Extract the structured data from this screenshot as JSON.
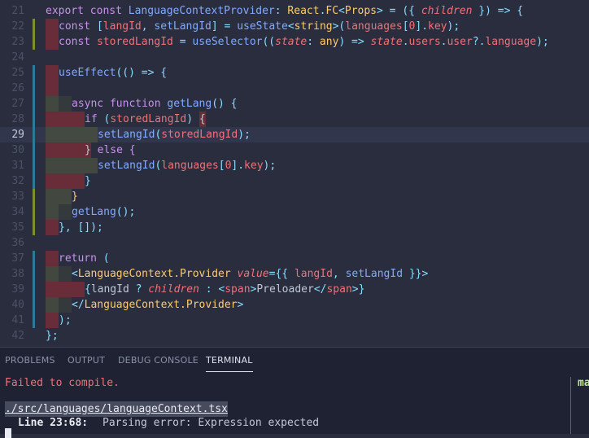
{
  "editor": {
    "active_line": "29",
    "lines": [
      {
        "num": "21",
        "gutter": "none",
        "tokens": [
          {
            "t": "export const ",
            "c": "kw"
          },
          {
            "t": "LanguageContextProvider",
            "c": "fn"
          },
          {
            "t": ": ",
            "c": "pu"
          },
          {
            "t": "React",
            "c": "ty"
          },
          {
            "t": ".",
            "c": "pu"
          },
          {
            "t": "FC",
            "c": "ty"
          },
          {
            "t": "<",
            "c": "pu"
          },
          {
            "t": "Props",
            "c": "ty"
          },
          {
            "t": "> = ({ ",
            "c": "pu"
          },
          {
            "t": "children",
            "c": "it"
          },
          {
            "t": " }) => {",
            "c": "pu"
          }
        ]
      },
      {
        "num": "22",
        "gutter": "add",
        "tokens": [
          {
            "t": "",
            "c": "rb",
            "w": 16
          },
          {
            "t": "const ",
            "c": "kw"
          },
          {
            "t": "[",
            "c": "pu"
          },
          {
            "t": "langId",
            "c": "vr"
          },
          {
            "t": ", ",
            "c": "pu"
          },
          {
            "t": "setLangId",
            "c": "fn"
          },
          {
            "t": "] = ",
            "c": "pu"
          },
          {
            "t": "useState",
            "c": "fn"
          },
          {
            "t": "<",
            "c": "pu"
          },
          {
            "t": "string",
            "c": "ty"
          },
          {
            "t": ">(",
            "c": "pu"
          },
          {
            "t": "languages",
            "c": "vr"
          },
          {
            "t": "[",
            "c": "pu"
          },
          {
            "t": "0",
            "c": "vr"
          },
          {
            "t": "].",
            "c": "pu"
          },
          {
            "t": "key",
            "c": "vr"
          },
          {
            "t": ");",
            "c": "pu"
          }
        ]
      },
      {
        "num": "23",
        "gutter": "add",
        "tokens": [
          {
            "t": "",
            "c": "rb",
            "w": 16
          },
          {
            "t": "const ",
            "c": "kw"
          },
          {
            "t": "storedLangId",
            "c": "vr"
          },
          {
            "t": " = ",
            "c": "pu"
          },
          {
            "t": "useSelector",
            "c": "fn"
          },
          {
            "t": "((",
            "c": "pu"
          },
          {
            "t": "state",
            "c": "it"
          },
          {
            "t": ": ",
            "c": "pu"
          },
          {
            "t": "any",
            "c": "ty"
          },
          {
            "t": ") => ",
            "c": "pu"
          },
          {
            "t": "state",
            "c": "it"
          },
          {
            "t": ".",
            "c": "pu"
          },
          {
            "t": "users",
            "c": "vr"
          },
          {
            "t": ".",
            "c": "pu"
          },
          {
            "t": "user",
            "c": "vr"
          },
          {
            "t": "?.",
            "c": "pu"
          },
          {
            "t": "language",
            "c": "vr"
          },
          {
            "t": ");",
            "c": "pu"
          }
        ]
      },
      {
        "num": "24",
        "gutter": "none",
        "tokens": []
      },
      {
        "num": "25",
        "gutter": "mod",
        "tokens": [
          {
            "t": "",
            "c": "rb",
            "w": 16
          },
          {
            "t": "useEffect",
            "c": "fn"
          },
          {
            "t": "(() => {",
            "c": "pu"
          }
        ]
      },
      {
        "num": "26",
        "gutter": "mod",
        "tokens": [
          {
            "t": "",
            "c": "rb",
            "w": 16
          }
        ]
      },
      {
        "num": "27",
        "gutter": "mod",
        "tokens": [
          {
            "t": "",
            "c": "gb",
            "w": 16
          },
          {
            "t": "",
            "c": "gl",
            "w": 16
          },
          {
            "t": "async function ",
            "c": "kw"
          },
          {
            "t": "getLang",
            "c": "fn"
          },
          {
            "t": "() {",
            "c": "pu"
          }
        ]
      },
      {
        "num": "28",
        "gutter": "mod",
        "tokens": [
          {
            "t": "",
            "c": "rb",
            "w": 16
          },
          {
            "t": "",
            "c": "rb",
            "w": 16
          },
          {
            "t": "",
            "c": "rb",
            "w": 16
          },
          {
            "t": "if ",
            "c": "kw"
          },
          {
            "t": "(",
            "c": "pu"
          },
          {
            "t": "storedLangId",
            "c": "vr"
          },
          {
            "t": ") ",
            "c": "pu"
          },
          {
            "t": "{",
            "c": "rb"
          }
        ]
      },
      {
        "num": "29",
        "gutter": "mod",
        "tokens": [
          {
            "t": "",
            "c": "gb",
            "w": 16
          },
          {
            "t": "",
            "c": "gb",
            "w": 16
          },
          {
            "t": "",
            "c": "gb",
            "w": 16
          },
          {
            "t": "",
            "c": "gb",
            "w": 16
          },
          {
            "t": "setLangId",
            "c": "fn"
          },
          {
            "t": "(",
            "c": "pu"
          },
          {
            "t": "storedLangId",
            "c": "vr"
          },
          {
            "t": ");",
            "c": "pu"
          }
        ]
      },
      {
        "num": "30",
        "gutter": "mod",
        "tokens": [
          {
            "t": "",
            "c": "rb",
            "w": 16
          },
          {
            "t": "",
            "c": "rb",
            "w": 16
          },
          {
            "t": "",
            "c": "rb",
            "w": 16
          },
          {
            "t": "}",
            "c": "rb"
          },
          {
            "t": " else {",
            "c": "kw"
          }
        ]
      },
      {
        "num": "31",
        "gutter": "mod",
        "tokens": [
          {
            "t": "",
            "c": "gb",
            "w": 16
          },
          {
            "t": "",
            "c": "gb",
            "w": 16
          },
          {
            "t": "",
            "c": "gb",
            "w": 16
          },
          {
            "t": "",
            "c": "gb",
            "w": 16
          },
          {
            "t": "setLangId",
            "c": "fn"
          },
          {
            "t": "(",
            "c": "pu"
          },
          {
            "t": "languages",
            "c": "vr"
          },
          {
            "t": "[",
            "c": "pu"
          },
          {
            "t": "0",
            "c": "vr"
          },
          {
            "t": "].",
            "c": "pu"
          },
          {
            "t": "key",
            "c": "vr"
          },
          {
            "t": ");",
            "c": "pu"
          }
        ]
      },
      {
        "num": "32",
        "gutter": "mod",
        "tokens": [
          {
            "t": "",
            "c": "rb",
            "w": 16
          },
          {
            "t": "",
            "c": "rb",
            "w": 16
          },
          {
            "t": "",
            "c": "rb",
            "w": 16
          },
          {
            "t": "}",
            "c": "pu"
          }
        ]
      },
      {
        "num": "33",
        "gutter": "add",
        "tokens": [
          {
            "t": "",
            "c": "gb",
            "w": 16
          },
          {
            "t": "",
            "c": "gb",
            "w": 16
          },
          {
            "t": "}",
            "c": "ty"
          }
        ]
      },
      {
        "num": "34",
        "gutter": "add",
        "tokens": [
          {
            "t": "",
            "c": "gb",
            "w": 16
          },
          {
            "t": "",
            "c": "gl",
            "w": 16
          },
          {
            "t": "getLang",
            "c": "fn"
          },
          {
            "t": "();",
            "c": "pu"
          }
        ]
      },
      {
        "num": "35",
        "gutter": "add",
        "tokens": [
          {
            "t": "",
            "c": "rb",
            "w": 16
          },
          {
            "t": "}, []);",
            "c": "pu"
          }
        ]
      },
      {
        "num": "36",
        "gutter": "none",
        "tokens": []
      },
      {
        "num": "37",
        "gutter": "mod",
        "tokens": [
          {
            "t": "",
            "c": "rb",
            "w": 16
          },
          {
            "t": "return ",
            "c": "kw"
          },
          {
            "t": "(",
            "c": "pu"
          }
        ]
      },
      {
        "num": "38",
        "gutter": "mod",
        "tokens": [
          {
            "t": "",
            "c": "gb",
            "w": 16
          },
          {
            "t": "",
            "c": "gl",
            "w": 16
          },
          {
            "t": "<",
            "c": "pu"
          },
          {
            "t": "LanguageContext.Provider ",
            "c": "ty"
          },
          {
            "t": "value",
            "c": "it"
          },
          {
            "t": "={{ ",
            "c": "pu"
          },
          {
            "t": "langId",
            "c": "vr"
          },
          {
            "t": ", ",
            "c": "pu"
          },
          {
            "t": "setLangId",
            "c": "fn"
          },
          {
            "t": " }}>",
            "c": "pu"
          }
        ]
      },
      {
        "num": "39",
        "gutter": "mod",
        "tokens": [
          {
            "t": "",
            "c": "rb",
            "w": 16
          },
          {
            "t": "",
            "c": "rb",
            "w": 16
          },
          {
            "t": "",
            "c": "rb",
            "w": 16
          },
          {
            "t": "{",
            "c": "pu"
          },
          {
            "t": "langId",
            "c": "tx"
          },
          {
            "t": " ? ",
            "c": "pu"
          },
          {
            "t": "children",
            "c": "it"
          },
          {
            "t": " : ",
            "c": "pu"
          },
          {
            "t": "<",
            "c": "pu"
          },
          {
            "t": "span",
            "c": "vr"
          },
          {
            "t": ">",
            "c": "pu"
          },
          {
            "t": "Preloader",
            "c": "tx"
          },
          {
            "t": "</",
            "c": "pu"
          },
          {
            "t": "span",
            "c": "vr"
          },
          {
            "t": ">}",
            "c": "pu"
          }
        ]
      },
      {
        "num": "40",
        "gutter": "mod",
        "tokens": [
          {
            "t": "",
            "c": "gb",
            "w": 16
          },
          {
            "t": "",
            "c": "gl",
            "w": 16
          },
          {
            "t": "</",
            "c": "pu"
          },
          {
            "t": "LanguageContext.Provider",
            "c": "ty"
          },
          {
            "t": ">",
            "c": "pu"
          }
        ]
      },
      {
        "num": "41",
        "gutter": "mod",
        "tokens": [
          {
            "t": "",
            "c": "rb",
            "w": 16
          },
          {
            "t": ");",
            "c": "pu"
          }
        ]
      },
      {
        "num": "42",
        "gutter": "none",
        "tokens": [
          {
            "t": "};",
            "c": "pu"
          }
        ]
      }
    ]
  },
  "panel": {
    "tabs": [
      "PROBLEMS",
      "OUTPUT",
      "DEBUG CONSOLE",
      "TERMINAL"
    ],
    "active_tab": "TERMINAL",
    "terminal": {
      "error": "Failed to compile.",
      "file": "./src/languages/languageContext.tsx",
      "location": "Line 23:68:",
      "message": "Parsing error: Expression expected",
      "side_text": "ma"
    }
  },
  "colors": {
    "editor_bg": "#292d3e",
    "panel_bg": "#1f2233",
    "keyword": "#c792ea",
    "function": "#82aaff",
    "type": "#ffcb6b",
    "variable": "#f07178",
    "punctuation": "#89ddff",
    "error": "#f07178",
    "success_text": "#c3e88d"
  }
}
